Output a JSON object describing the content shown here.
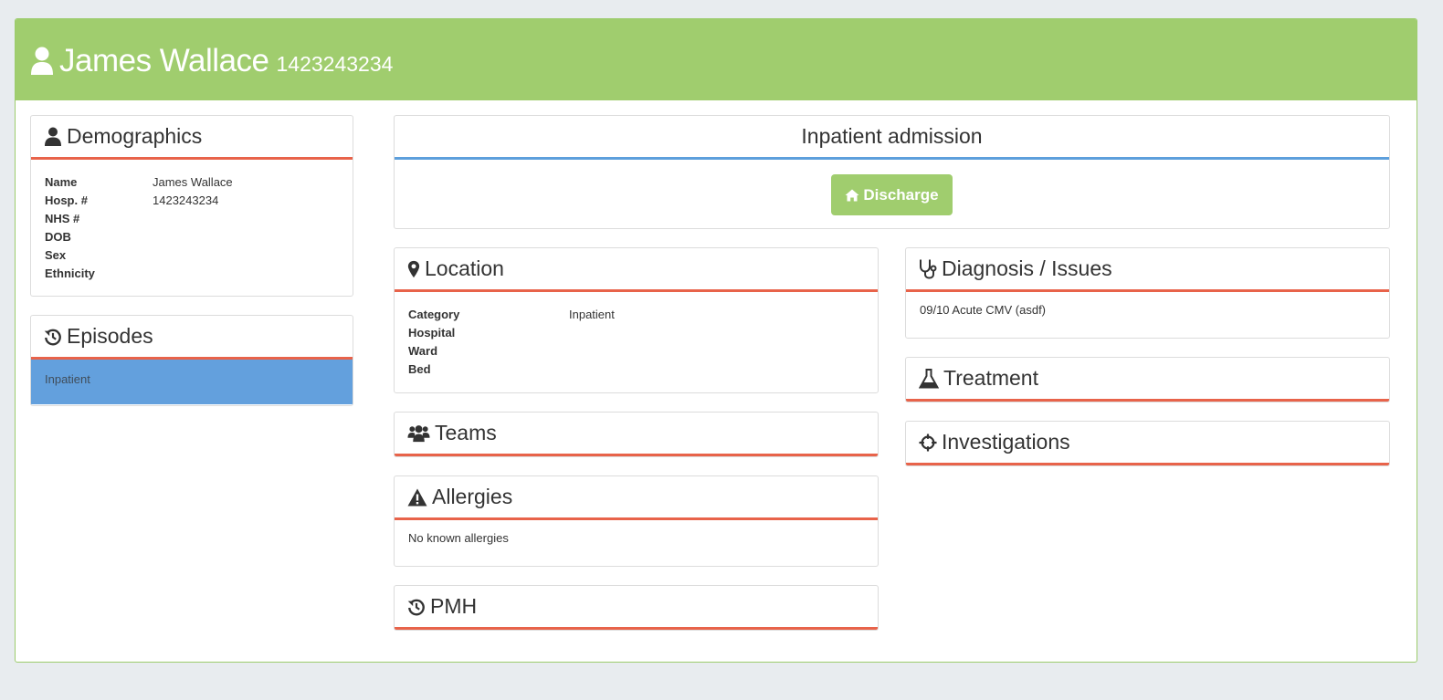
{
  "patient": {
    "name": "James Wallace",
    "hosp_number": "1423243234"
  },
  "demographics": {
    "title": "Demographics",
    "fields": [
      {
        "label": "Name",
        "value": "James Wallace"
      },
      {
        "label": "Hosp. #",
        "value": "1423243234"
      },
      {
        "label": "NHS #",
        "value": ""
      },
      {
        "label": "DOB",
        "value": ""
      },
      {
        "label": "Sex",
        "value": ""
      },
      {
        "label": "Ethnicity",
        "value": ""
      }
    ]
  },
  "episodes": {
    "title": "Episodes",
    "items": [
      "Inpatient"
    ]
  },
  "admission": {
    "title": "Inpatient admission",
    "discharge_label": "Discharge"
  },
  "location": {
    "title": "Location",
    "fields": [
      {
        "label": "Category",
        "value": "Inpatient"
      },
      {
        "label": "Hospital",
        "value": ""
      },
      {
        "label": "Ward",
        "value": ""
      },
      {
        "label": "Bed",
        "value": ""
      }
    ]
  },
  "teams": {
    "title": "Teams"
  },
  "allergies": {
    "title": "Allergies",
    "text": "No known allergies"
  },
  "pmh": {
    "title": "PMH"
  },
  "diagnosis": {
    "title": "Diagnosis / Issues",
    "items": [
      "09/10 Acute CMV (asdf)"
    ]
  },
  "treatment": {
    "title": "Treatment"
  },
  "investigations": {
    "title": "Investigations"
  },
  "colors": {
    "header_green": "#a0cd6e",
    "accent_red": "#e8634a",
    "accent_blue": "#5d9fdc",
    "episode_blue": "#63a0dd"
  },
  "icons": {
    "header": "user-icon",
    "demographics": "user-icon",
    "episodes": "history-icon",
    "discharge": "home-icon",
    "location": "map-marker-icon",
    "teams": "users-icon",
    "allergies": "warning-icon",
    "pmh": "history-icon",
    "diagnosis": "stethoscope-icon",
    "treatment": "flask-icon",
    "investigations": "crosshairs-icon"
  }
}
